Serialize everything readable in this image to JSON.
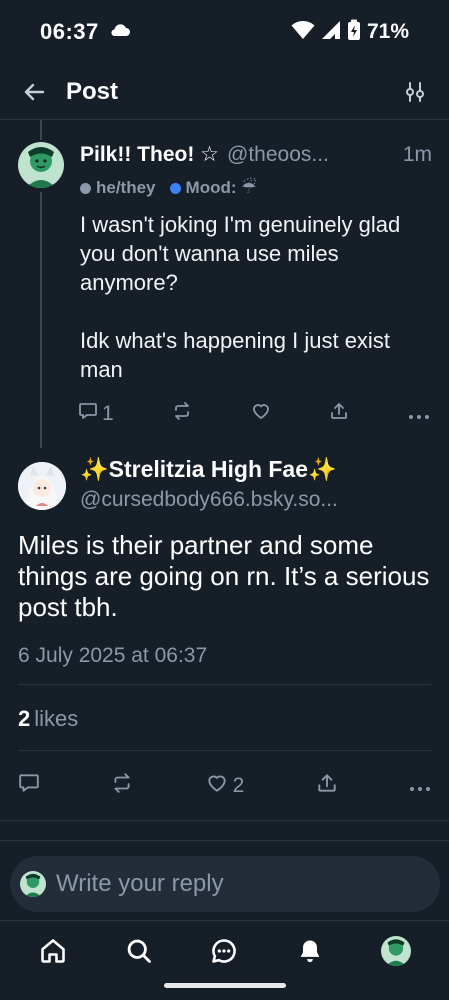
{
  "status_bar": {
    "time": "06:37",
    "battery": "71%",
    "icons": [
      "cloud-icon",
      "wifi-icon",
      "signal-icon",
      "battery-charging-icon"
    ]
  },
  "header": {
    "title": "Post",
    "back_icon": "arrow-left-icon",
    "settings_icon": "sliders-icon"
  },
  "parent_post": {
    "display_name": "Pilk!! Theo! ☆",
    "handle": "@theoos...",
    "timestamp": "1m",
    "pronouns": "he/they",
    "mood": "Mood: ☔",
    "paragraphs": [
      "I wasn't joking I'm genuinely glad you don't wanna use miles anymore?",
      "Idk what's happening I just exist man"
    ],
    "reply_count": "1",
    "like_count": ""
  },
  "main_post": {
    "display_name": "✨Strelitzia High Fae✨",
    "handle": "@cursedbody666.bsky.so...",
    "text": "Miles is their partner and some things are going on rn. It’s a serious post tbh.",
    "date": "6 July 2025 at 06:37",
    "likes_count": "2",
    "likes_label": "likes",
    "like_count_action": "2"
  },
  "reply_bar": {
    "placeholder": "Write your reply"
  },
  "bottom_nav": [
    "home-icon",
    "search-icon",
    "chat-icon",
    "bell-icon",
    "profile-avatar"
  ],
  "colors": {
    "background": "#161e27",
    "muted": "#8b98a8",
    "divider": "#2a3440",
    "text": "#f1f3f5"
  }
}
